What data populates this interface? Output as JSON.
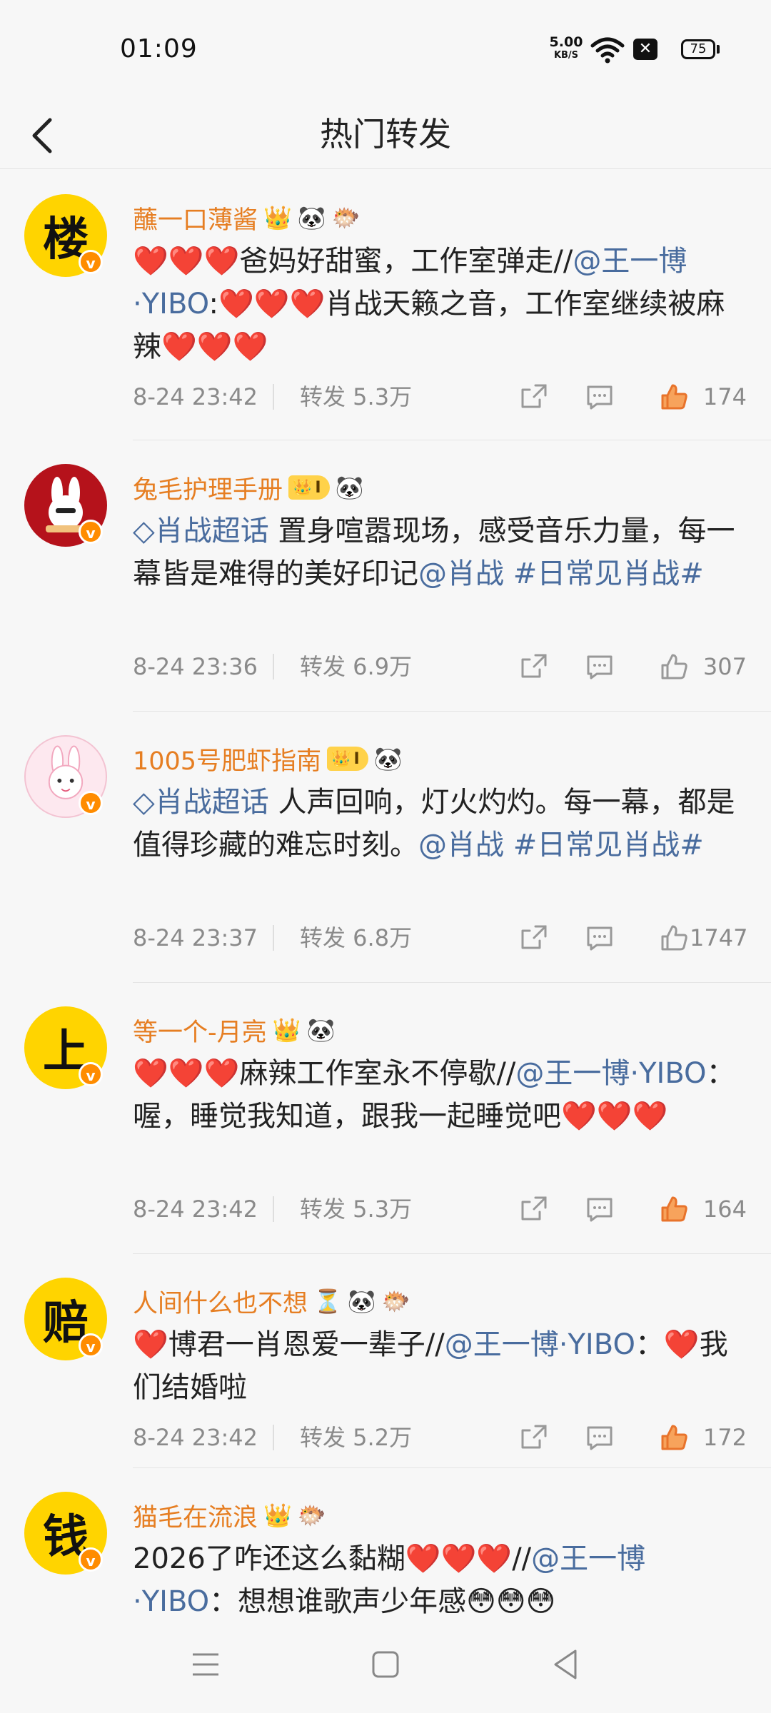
{
  "status": {
    "time": "01:09",
    "net_speed": "5.00",
    "net_unit": "KB/S",
    "battery": "75"
  },
  "header": {
    "title": "热门转发"
  },
  "posts": [
    {
      "avatar_char": "楼",
      "name": "蘸一口薄酱",
      "badges": [
        "👑",
        "🐼",
        "🐡"
      ],
      "body": [
        {
          "t": "❤️❤️❤️爸妈好甜蜜，工作室弹走//"
        },
        {
          "t": "@王一博·YIBO",
          "link": true
        },
        {
          "t": ":❤️❤️❤️肖战天籁之音，工作室继续被麻辣❤️❤️❤️"
        }
      ],
      "time": "8-24 23:42",
      "repost": "转发 5.3万",
      "likes": "174",
      "liked": true
    },
    {
      "avatar_char": "",
      "name": "兔毛护理手册",
      "vip": "I",
      "badges": [
        "🐼"
      ],
      "body": [
        {
          "t": "◇肖战超话",
          "link": true
        },
        {
          "t": " 置身喧嚣现场，感受音乐力量，每一幕皆是难得的美好印记"
        },
        {
          "t": "@肖战",
          "link": true
        },
        {
          "t": " "
        },
        {
          "t": "#日常见肖战#",
          "link": true
        }
      ],
      "time": "8-24 23:36",
      "repost": "转发 6.9万",
      "likes": "307",
      "liked": false
    },
    {
      "avatar_char": "",
      "name": "1005号肥虾指南",
      "vip": "I",
      "badges": [
        "🐼"
      ],
      "body": [
        {
          "t": "◇肖战超话",
          "link": true
        },
        {
          "t": " 人声回响，灯火灼灼。每一幕，都是值得珍藏的难忘时刻。"
        },
        {
          "t": "@肖战",
          "link": true
        },
        {
          "t": " "
        },
        {
          "t": "#日常见肖战#",
          "link": true
        }
      ],
      "time": "8-24 23:37",
      "repost": "转发 6.8万",
      "likes": "1747",
      "liked": false
    },
    {
      "avatar_char": "上",
      "name": "等一个-月亮",
      "badges": [
        "👑",
        "🐼"
      ],
      "body": [
        {
          "t": "❤️❤️❤️麻辣工作室永不停歇//"
        },
        {
          "t": "@王一博·YIBO",
          "link": true
        },
        {
          "t": "：喔，睡觉我知道，跟我一起睡觉吧❤️❤️❤️"
        }
      ],
      "time": "8-24 23:42",
      "repost": "转发 5.3万",
      "likes": "164",
      "liked": true
    },
    {
      "avatar_char": "赔",
      "name": "人间什么也不想",
      "badges": [
        "⏳",
        "🐼",
        "🐡"
      ],
      "body": [
        {
          "t": "❤️博君一肖恩爱一辈子//"
        },
        {
          "t": "@王一博·YIBO",
          "link": true
        },
        {
          "t": "：❤️我们结婚啦"
        }
      ],
      "time": "8-24 23:42",
      "repost": "转发 5.2万",
      "likes": "172",
      "liked": true
    },
    {
      "avatar_char": "钱",
      "name": "猫毛在流浪",
      "badges": [
        "👑",
        "🐡"
      ],
      "body": [
        {
          "t": "2026了咋还这么黏糊❤️❤️❤️//"
        },
        {
          "t": "@王一博·YIBO",
          "link": true
        },
        {
          "t": "：想想谁歌声少年感😳😳😳"
        }
      ]
    }
  ]
}
